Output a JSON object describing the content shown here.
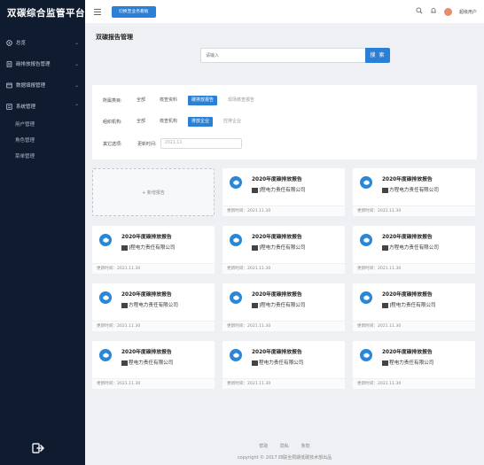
{
  "app": {
    "title": "双碳综合监管平台"
  },
  "sidebar": {
    "items": [
      {
        "icon": "home-icon",
        "label": "总览"
      },
      {
        "icon": "report-icon",
        "label": "碳排放报告管理"
      },
      {
        "icon": "data-icon",
        "label": "数据填报管理"
      },
      {
        "icon": "settings-icon",
        "label": "系统管理"
      }
    ],
    "sub_items": [
      "用户管理",
      "角色管理",
      "菜单管理"
    ]
  },
  "topbar": {
    "switch_label": "切换至业务看板",
    "user_name": "超级用户"
  },
  "main": {
    "title": "双碳报告管理",
    "search": {
      "placeholder": "请输入",
      "button": "搜 索"
    }
  },
  "filters": {
    "category": {
      "label": "所属类目:",
      "options": [
        "全部",
        "核查资料",
        "碳排放报告",
        "现场核查报告"
      ],
      "active": 2
    },
    "org": {
      "label": "组织机构:",
      "options": [
        "全部",
        "核查机构",
        "排放企业",
        "控排企业"
      ],
      "active": 2
    },
    "other": {
      "label": "其它选项:",
      "date_label": "更新时间:",
      "date_placeholder": "2021.11"
    }
  },
  "add_card": {
    "label": "+ 新增报告"
  },
  "cards": [
    {
      "title": "2020年度碳排放报告",
      "company": "]程电力责任有限公司",
      "footer": "更新时间：2021.11.30"
    },
    {
      "title": "2020年度碳排放报告",
      "company": "方程电力责任有限公司",
      "footer": "更新时间：2021.11.30"
    },
    {
      "title": "2020年度碳排放报告",
      "company": "]程电力责任有限公司",
      "footer": "更新时间：2021.11.30"
    },
    {
      "title": "2020年度碳排放报告",
      "company": "]程电力责任有限公司",
      "footer": "更新时间：2021.11.30"
    },
    {
      "title": "2020年度碳排放报告",
      "company": "方程电力责任有限公司",
      "footer": "更新时间：2021.11.30"
    },
    {
      "title": "2020年度碳排放报告",
      "company": "方程电力责任有限公司",
      "footer": "更新时间：2021.11.30"
    },
    {
      "title": "2020年度碳排放报告",
      "company": "]程电力责任有限公司",
      "footer": "更新时间：2021.11.30"
    },
    {
      "title": "2020年度碳排放报告",
      "company": "]程电力责任有限公司",
      "footer": "更新时间：2021.11.30"
    },
    {
      "title": "2020年度碳排放报告",
      "company": "程电力责任有限公司",
      "footer": "更新时间：2021.11.30"
    },
    {
      "title": "2020年度碳排放报告",
      "company": "程电力责任有限公司",
      "footer": "更新时间：2021.11.30"
    },
    {
      "title": "2020年度碳排放报告",
      "company": "程电力责任有限公司",
      "footer": "更新时间：2021.11.30"
    }
  ],
  "footer": {
    "links": [
      "帮助",
      "隐私",
      "条款"
    ],
    "copyright": "copyright © 2017 四联全周期低碳技术部出品"
  },
  "colors": {
    "sidebar_bg": "#0f1c30",
    "accent": "#2a7fd6",
    "icon_blue": "#2a87d8"
  }
}
